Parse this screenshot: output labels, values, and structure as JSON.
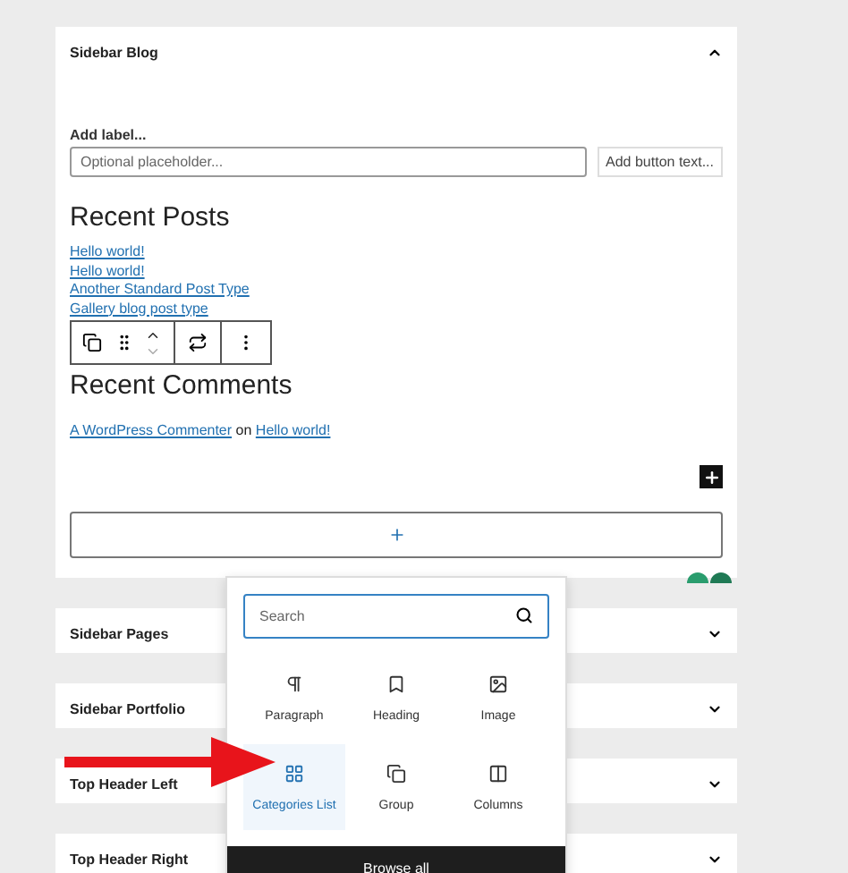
{
  "areas": [
    {
      "title": "Sidebar Blog",
      "expanded": true
    },
    {
      "title": "Sidebar Pages",
      "expanded": false
    },
    {
      "title": "Sidebar Portfolio",
      "expanded": false
    },
    {
      "title": "Top Header Left",
      "expanded": false
    },
    {
      "title": "Top Header Right",
      "expanded": false
    }
  ],
  "search_form": {
    "label": "Add label...",
    "placeholder": "Optional placeholder...",
    "button": "Add button text..."
  },
  "recent_posts": {
    "heading": "Recent Posts",
    "links": [
      "Hello world!",
      "Hello world!",
      "Another Standard Post Type",
      "Gallery blog post type"
    ]
  },
  "recent_comments": {
    "heading": "Recent Comments",
    "author": "A WordPress Commenter",
    "connector": "on",
    "post": "Hello world!"
  },
  "inserter": {
    "search_placeholder": "Search",
    "blocks": [
      {
        "label": "Paragraph",
        "kind": "paragraph",
        "selected": false
      },
      {
        "label": "Heading",
        "kind": "heading",
        "selected": false
      },
      {
        "label": "Image",
        "kind": "image",
        "selected": false
      },
      {
        "label": "Categories List",
        "kind": "grid",
        "selected": true
      },
      {
        "label": "Group",
        "kind": "group",
        "selected": false
      },
      {
        "label": "Columns",
        "kind": "columns",
        "selected": false
      }
    ],
    "browse_all": "Browse all"
  }
}
